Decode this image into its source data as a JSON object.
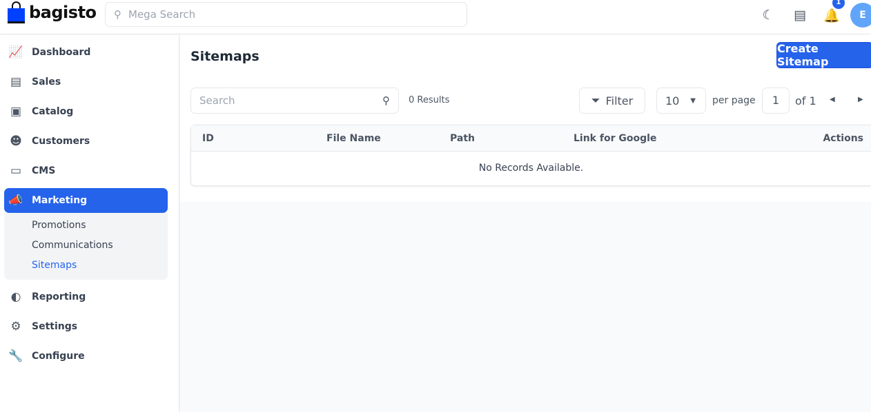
{
  "brand": {
    "name": "bagisto",
    "accent": "#2563eb"
  },
  "header": {
    "search_placeholder": "Mega Search",
    "notifications_count": "1",
    "avatar_initial": "E"
  },
  "sidebar": {
    "items": [
      {
        "label": "Dashboard"
      },
      {
        "label": "Sales"
      },
      {
        "label": "Catalog"
      },
      {
        "label": "Customers"
      },
      {
        "label": "CMS"
      },
      {
        "label": "Marketing"
      },
      {
        "label": "Reporting"
      },
      {
        "label": "Settings"
      },
      {
        "label": "Configure"
      }
    ],
    "marketing_sub": [
      {
        "label": "Promotions"
      },
      {
        "label": "Communications"
      },
      {
        "label": "Sitemaps"
      }
    ]
  },
  "main": {
    "title": "Sitemaps",
    "create_label": "Create Sitemap",
    "search_placeholder": "Search",
    "results": "0 Results",
    "filter_label": "Filter",
    "per_page_value": "10",
    "per_page_label": "per page",
    "page": "1",
    "of_pages": "of 1",
    "columns": [
      "ID",
      "File Name",
      "Path",
      "Link for Google",
      "Actions"
    ],
    "empty": "No Records Available."
  }
}
